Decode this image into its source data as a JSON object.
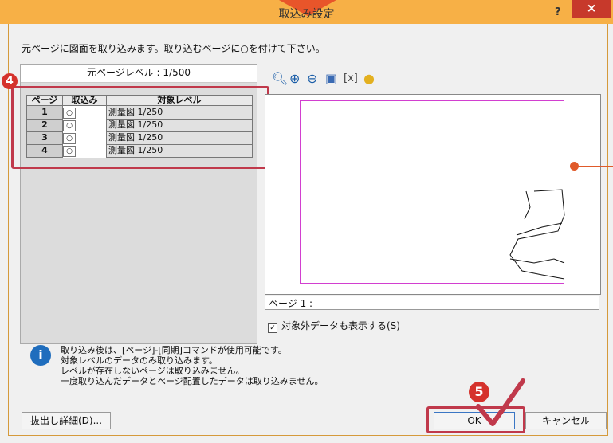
{
  "window": {
    "title": "取込み設定",
    "help_label": "?",
    "close_label": "×"
  },
  "instruction": "元ページに図面を取り込みます。取り込むページに○を付けて下さい。",
  "left_panel": {
    "source_level": "元ページレベル : 1/500"
  },
  "table": {
    "headers": [
      "ページ",
      "取込み",
      "対象レベル"
    ],
    "rows": [
      {
        "page": "1",
        "import": "○",
        "level": "測量図 1/250"
      },
      {
        "page": "2",
        "import": "○",
        "level": "測量図 1/250"
      },
      {
        "page": "3",
        "import": "○",
        "level": "測量図 1/250"
      },
      {
        "page": "4",
        "import": "○",
        "level": "測量図 1/250"
      }
    ]
  },
  "badges": [
    "4",
    "5"
  ],
  "toolbar": {
    "icons": [
      "zoom-fit-icon",
      "zoom-in-icon",
      "zoom-out-icon",
      "import-page-icon",
      "fit-window-icon",
      "hint-bulb-icon"
    ]
  },
  "preview": {
    "page_label": "ページ 1 :"
  },
  "checkbox": {
    "label": "対象外データも表示する(S)",
    "checked": true
  },
  "info": {
    "lines": [
      "取り込み後は、[ページ]-[同期]コマンドが使用可能です。",
      "対象レベルのデータのみ取り込みます。",
      "レベルが存在しないページは取り込みません。",
      "一度取り込んだデータとページ配置したデータは取り込みません。"
    ]
  },
  "buttons": {
    "detail": "抜出し詳細(D)...",
    "ok": "OK",
    "cancel": "キャンセル"
  },
  "colors": {
    "title_bar": "#f7b046",
    "close": "#c7392b",
    "highlight": "#c0394b",
    "badge": "#d5322c",
    "preview_frame": "#d23fd0"
  }
}
